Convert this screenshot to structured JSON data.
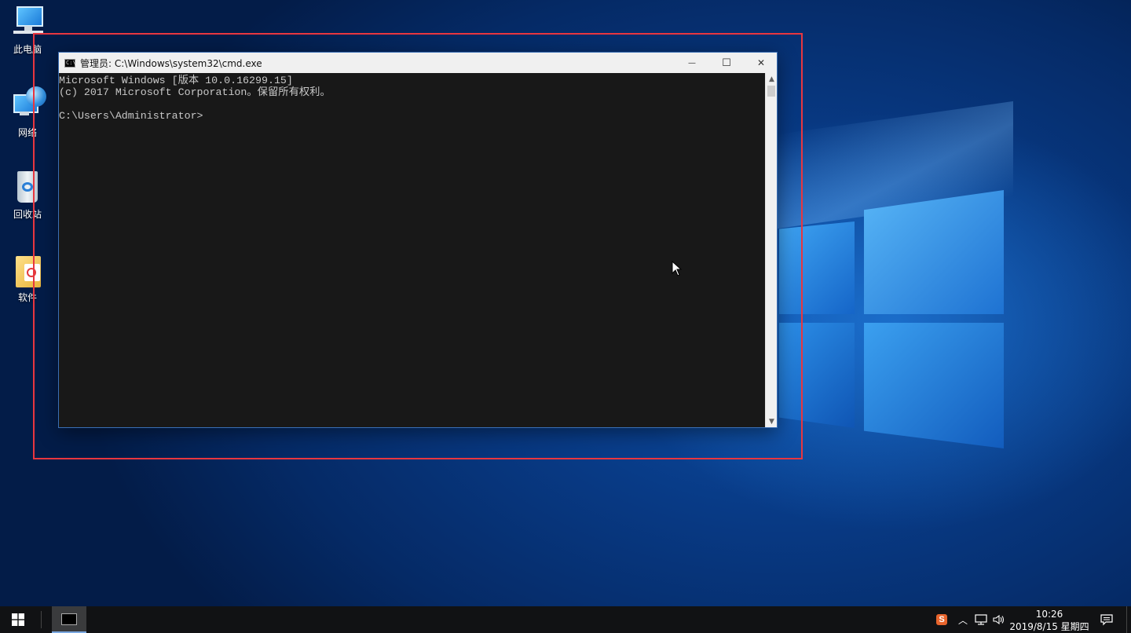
{
  "desktop": {
    "icons": [
      {
        "label": "此电脑",
        "icon": "this-pc-icon"
      },
      {
        "label": "网络",
        "icon": "network-icon"
      },
      {
        "label": "回收站",
        "icon": "recycle-bin-icon"
      },
      {
        "label": "软件",
        "icon": "folder-icon"
      }
    ]
  },
  "cmd_window": {
    "title": "管理员: C:\\Windows\\system32\\cmd.exe",
    "minimize_glyph": "—",
    "maximize_glyph": "☐",
    "close_glyph": "✕",
    "console_lines": [
      "Microsoft Windows [版本 10.0.16299.15]",
      "(c) 2017 Microsoft Corporation。保留所有权利。",
      "",
      "C:\\Users\\Administrator>"
    ]
  },
  "taskbar": {
    "clock_time": "10:26",
    "clock_date": "2019/8/15 星期四",
    "ime_label": "S",
    "running_app": "cmd-icon"
  },
  "colors": {
    "highlight_frame": "#e8363f",
    "taskbar_bg": "#111214",
    "console_bg": "#181818"
  }
}
